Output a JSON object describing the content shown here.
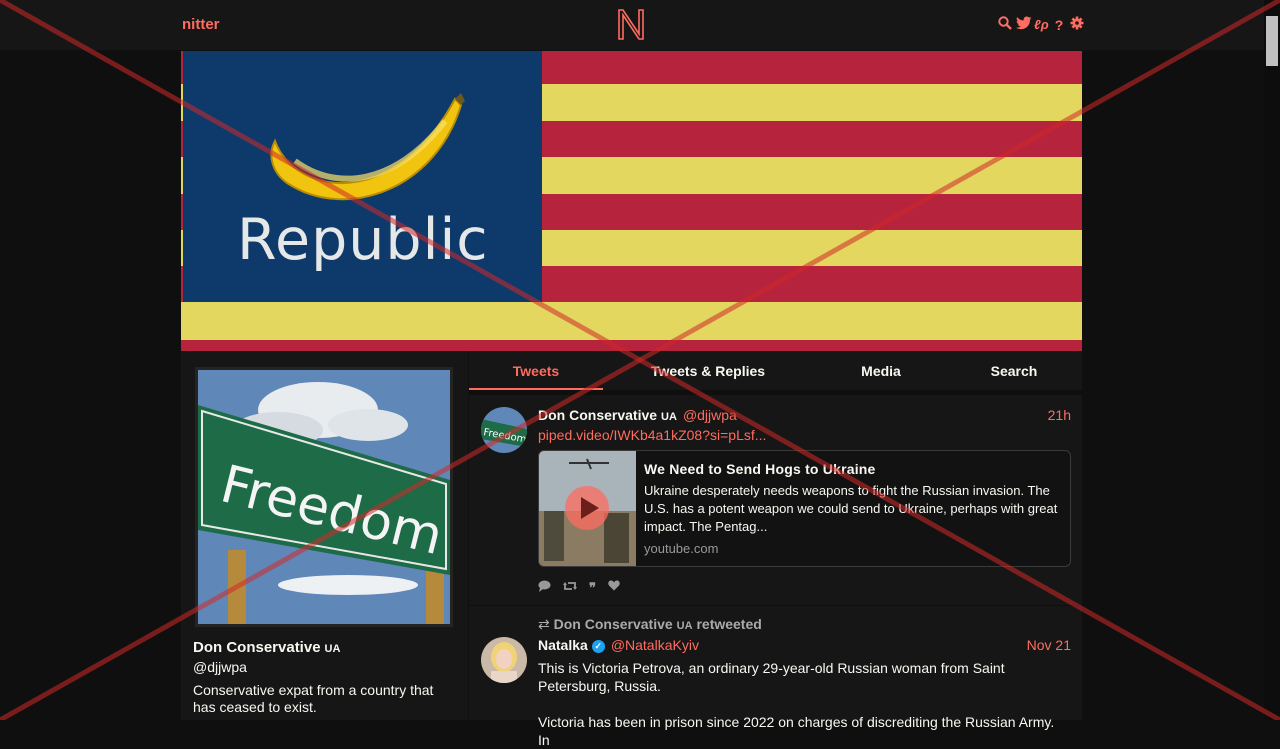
{
  "nav": {
    "brand": "nitter",
    "logo_letter": "N",
    "icons": [
      "search-icon",
      "twitter-icon",
      "lp-icon",
      "help-icon",
      "settings-icon"
    ],
    "icon_glyphs": [
      "⚲",
      "🐦",
      "ℓρ",
      "?",
      "⚙"
    ]
  },
  "banner": {
    "text": "Republic",
    "colors": {
      "blue": "#0e3a6b",
      "red": "#b5233d",
      "yellow": "#e3d760"
    }
  },
  "profile": {
    "name": "Don Conservative",
    "flag_badge": "UA",
    "handle": "@djjwpa",
    "bio": "Conservative expat from a country that has ceased to exist.",
    "pic_text": "Freedom"
  },
  "tabs": [
    {
      "label": "Tweets",
      "active": true
    },
    {
      "label": "Tweets & Replies",
      "active": false
    },
    {
      "label": "Media",
      "active": false
    },
    {
      "label": "Search",
      "active": false
    }
  ],
  "tweets": [
    {
      "name": "Don Conservative",
      "badge": "UA",
      "handle": "@djjwpa",
      "time": "21h",
      "link": "piped.video/IWKb4a1kZ08?si=pLsf...",
      "avatar_text": "Freedom",
      "card": {
        "title": "We Need to Send Hogs to Ukraine",
        "description": "Ukraine desperately needs weapons to fight the Russian invasion. The U.S. has a potent weapon we could send to Ukraine, perhaps with great impact. The Pentag...",
        "destination": "youtube.com"
      }
    },
    {
      "retweet_by": "Don Conservative",
      "retweet_badge": "UA",
      "retweet_suffix": "retweeted",
      "name": "Natalka",
      "handle": "@NatalkaKyiv",
      "time": "Nov 21",
      "text": "This is Victoria Petrova, an ordinary 29-year-old Russian woman from Saint Petersburg, Russia.",
      "text2": "Victoria has been in prison since 2022 on charges of discrediting the Russian Army. In"
    }
  ],
  "accent_color": "#ff6c60"
}
